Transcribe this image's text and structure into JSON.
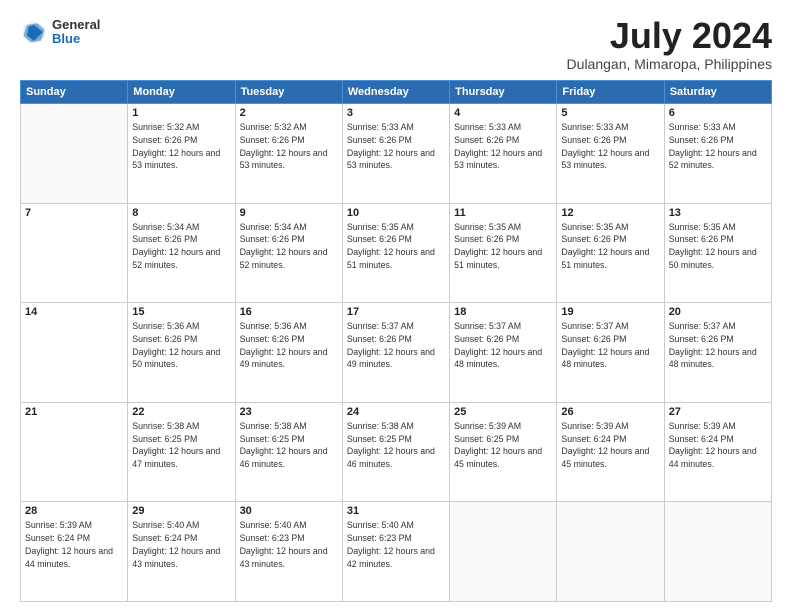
{
  "header": {
    "logo_general": "General",
    "logo_blue": "Blue",
    "title": "July 2024",
    "location": "Dulangan, Mimaropa, Philippines"
  },
  "calendar": {
    "days_of_week": [
      "Sunday",
      "Monday",
      "Tuesday",
      "Wednesday",
      "Thursday",
      "Friday",
      "Saturday"
    ],
    "weeks": [
      [
        {
          "day": "",
          "info": ""
        },
        {
          "day": "1",
          "info": "Sunrise: 5:32 AM\nSunset: 6:26 PM\nDaylight: 12 hours\nand 53 minutes."
        },
        {
          "day": "2",
          "info": "Sunrise: 5:32 AM\nSunset: 6:26 PM\nDaylight: 12 hours\nand 53 minutes."
        },
        {
          "day": "3",
          "info": "Sunrise: 5:33 AM\nSunset: 6:26 PM\nDaylight: 12 hours\nand 53 minutes."
        },
        {
          "day": "4",
          "info": "Sunrise: 5:33 AM\nSunset: 6:26 PM\nDaylight: 12 hours\nand 53 minutes."
        },
        {
          "day": "5",
          "info": "Sunrise: 5:33 AM\nSunset: 6:26 PM\nDaylight: 12 hours\nand 53 minutes."
        },
        {
          "day": "6",
          "info": "Sunrise: 5:33 AM\nSunset: 6:26 PM\nDaylight: 12 hours\nand 52 minutes."
        }
      ],
      [
        {
          "day": "7",
          "info": ""
        },
        {
          "day": "8",
          "info": "Sunrise: 5:34 AM\nSunset: 6:26 PM\nDaylight: 12 hours\nand 52 minutes."
        },
        {
          "day": "9",
          "info": "Sunrise: 5:34 AM\nSunset: 6:26 PM\nDaylight: 12 hours\nand 52 minutes."
        },
        {
          "day": "10",
          "info": "Sunrise: 5:35 AM\nSunset: 6:26 PM\nDaylight: 12 hours\nand 51 minutes."
        },
        {
          "day": "11",
          "info": "Sunrise: 5:35 AM\nSunset: 6:26 PM\nDaylight: 12 hours\nand 51 minutes."
        },
        {
          "day": "12",
          "info": "Sunrise: 5:35 AM\nSunset: 6:26 PM\nDaylight: 12 hours\nand 51 minutes."
        },
        {
          "day": "13",
          "info": "Sunrise: 5:35 AM\nSunset: 6:26 PM\nDaylight: 12 hours\nand 50 minutes."
        }
      ],
      [
        {
          "day": "14",
          "info": ""
        },
        {
          "day": "15",
          "info": "Sunrise: 5:36 AM\nSunset: 6:26 PM\nDaylight: 12 hours\nand 50 minutes."
        },
        {
          "day": "16",
          "info": "Sunrise: 5:36 AM\nSunset: 6:26 PM\nDaylight: 12 hours\nand 49 minutes."
        },
        {
          "day": "17",
          "info": "Sunrise: 5:37 AM\nSunset: 6:26 PM\nDaylight: 12 hours\nand 49 minutes."
        },
        {
          "day": "18",
          "info": "Sunrise: 5:37 AM\nSunset: 6:26 PM\nDaylight: 12 hours\nand 48 minutes."
        },
        {
          "day": "19",
          "info": "Sunrise: 5:37 AM\nSunset: 6:26 PM\nDaylight: 12 hours\nand 48 minutes."
        },
        {
          "day": "20",
          "info": "Sunrise: 5:37 AM\nSunset: 6:26 PM\nDaylight: 12 hours\nand 48 minutes."
        }
      ],
      [
        {
          "day": "21",
          "info": ""
        },
        {
          "day": "22",
          "info": "Sunrise: 5:38 AM\nSunset: 6:25 PM\nDaylight: 12 hours\nand 47 minutes."
        },
        {
          "day": "23",
          "info": "Sunrise: 5:38 AM\nSunset: 6:25 PM\nDaylight: 12 hours\nand 46 minutes."
        },
        {
          "day": "24",
          "info": "Sunrise: 5:38 AM\nSunset: 6:25 PM\nDaylight: 12 hours\nand 46 minutes."
        },
        {
          "day": "25",
          "info": "Sunrise: 5:39 AM\nSunset: 6:25 PM\nDaylight: 12 hours\nand 45 minutes."
        },
        {
          "day": "26",
          "info": "Sunrise: 5:39 AM\nSunset: 6:24 PM\nDaylight: 12 hours\nand 45 minutes."
        },
        {
          "day": "27",
          "info": "Sunrise: 5:39 AM\nSunset: 6:24 PM\nDaylight: 12 hours\nand 44 minutes."
        }
      ],
      [
        {
          "day": "28",
          "info": "Sunrise: 5:39 AM\nSunset: 6:24 PM\nDaylight: 12 hours\nand 44 minutes."
        },
        {
          "day": "29",
          "info": "Sunrise: 5:40 AM\nSunset: 6:24 PM\nDaylight: 12 hours\nand 43 minutes."
        },
        {
          "day": "30",
          "info": "Sunrise: 5:40 AM\nSunset: 6:23 PM\nDaylight: 12 hours\nand 43 minutes."
        },
        {
          "day": "31",
          "info": "Sunrise: 5:40 AM\nSunset: 6:23 PM\nDaylight: 12 hours\nand 42 minutes."
        },
        {
          "day": "",
          "info": ""
        },
        {
          "day": "",
          "info": ""
        },
        {
          "day": "",
          "info": ""
        }
      ]
    ]
  }
}
